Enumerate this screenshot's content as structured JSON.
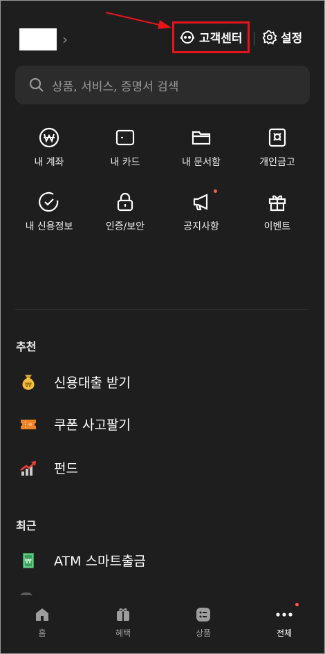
{
  "header": {
    "customer_center_label": "고객센터",
    "settings_label": "설정",
    "accent_color": "#e8141c"
  },
  "search": {
    "placeholder": "상품, 서비스, 증명서 검색"
  },
  "quick_menu": [
    {
      "label": "내 계좌",
      "icon": "won-circle-icon"
    },
    {
      "label": "내 카드",
      "icon": "card-icon"
    },
    {
      "label": "내 문서함",
      "icon": "folder-icon"
    },
    {
      "label": "개인금고",
      "icon": "safe-icon"
    },
    {
      "label": "내 신용정보",
      "icon": "check-circle-icon"
    },
    {
      "label": "인증/보안",
      "icon": "lock-icon"
    },
    {
      "label": "공지사항",
      "icon": "megaphone-icon",
      "badge": true
    },
    {
      "label": "이벤트",
      "icon": "gift-icon"
    }
  ],
  "recommend": {
    "title": "추천",
    "items": [
      {
        "label": "신용대출 받기",
        "icon": "money-bag-icon"
      },
      {
        "label": "쿠폰 사고팔기",
        "icon": "ticket-icon"
      },
      {
        "label": "펀드",
        "icon": "chart-up-icon"
      }
    ]
  },
  "recent": {
    "title": "최근",
    "items": [
      {
        "label": "ATM 스마트출금",
        "icon": "banknote-icon"
      }
    ]
  },
  "tabbar": {
    "items": [
      {
        "label": "홈",
        "icon": "home-icon"
      },
      {
        "label": "혜택",
        "icon": "gift-box-icon"
      },
      {
        "label": "상품",
        "icon": "list-icon"
      },
      {
        "label": "전체",
        "icon": "more-icon",
        "active": true,
        "badge": true
      }
    ]
  }
}
